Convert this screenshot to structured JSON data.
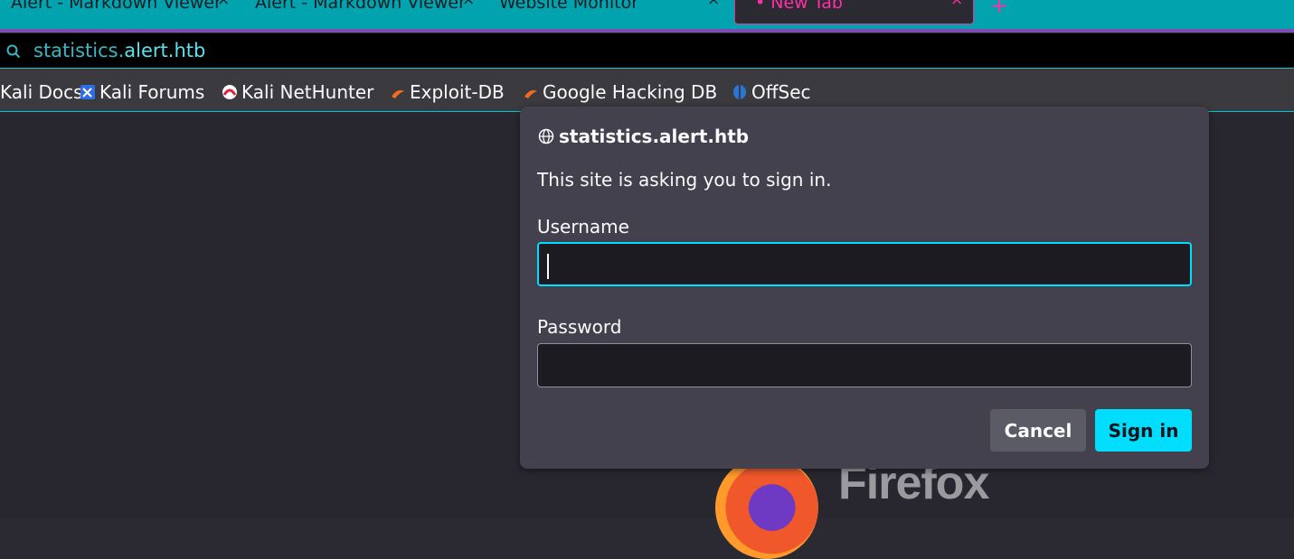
{
  "tabs": [
    {
      "title": "Alert - Markdown Viewer",
      "close": "×"
    },
    {
      "title": "Alert - Markdown Viewer",
      "close": "×"
    },
    {
      "title": "Website Monitor",
      "close": "×"
    },
    {
      "title": "• New Tab",
      "close": "×",
      "active": true
    }
  ],
  "new_tab_label": "+",
  "url": {
    "host": "statistics.",
    "domain": "alert.htb"
  },
  "bookmarks": [
    {
      "label": "Kali Docs",
      "icon": "kali-docs-icon"
    },
    {
      "label": "Kali Forums",
      "icon": "kali-forums-icon"
    },
    {
      "label": "Kali NetHunter",
      "icon": "kali-nethunter-icon"
    },
    {
      "label": "Exploit-DB",
      "icon": "exploit-db-icon"
    },
    {
      "label": "Google Hacking DB",
      "icon": "ghdb-icon"
    },
    {
      "label": "OffSec",
      "icon": "offsec-icon"
    }
  ],
  "dialog": {
    "host": "statistics.alert.htb",
    "message": "This site is asking you to sign in.",
    "username_label": "Username",
    "username_value": "",
    "password_label": "Password",
    "password_value": "",
    "cancel": "Cancel",
    "signin": "Sign in"
  },
  "branding": {
    "wordmark": "Firefox"
  },
  "colors": {
    "accent": "#00ddff",
    "tabbar": "#00a3ae",
    "active_tab": "#ff2fa5"
  }
}
